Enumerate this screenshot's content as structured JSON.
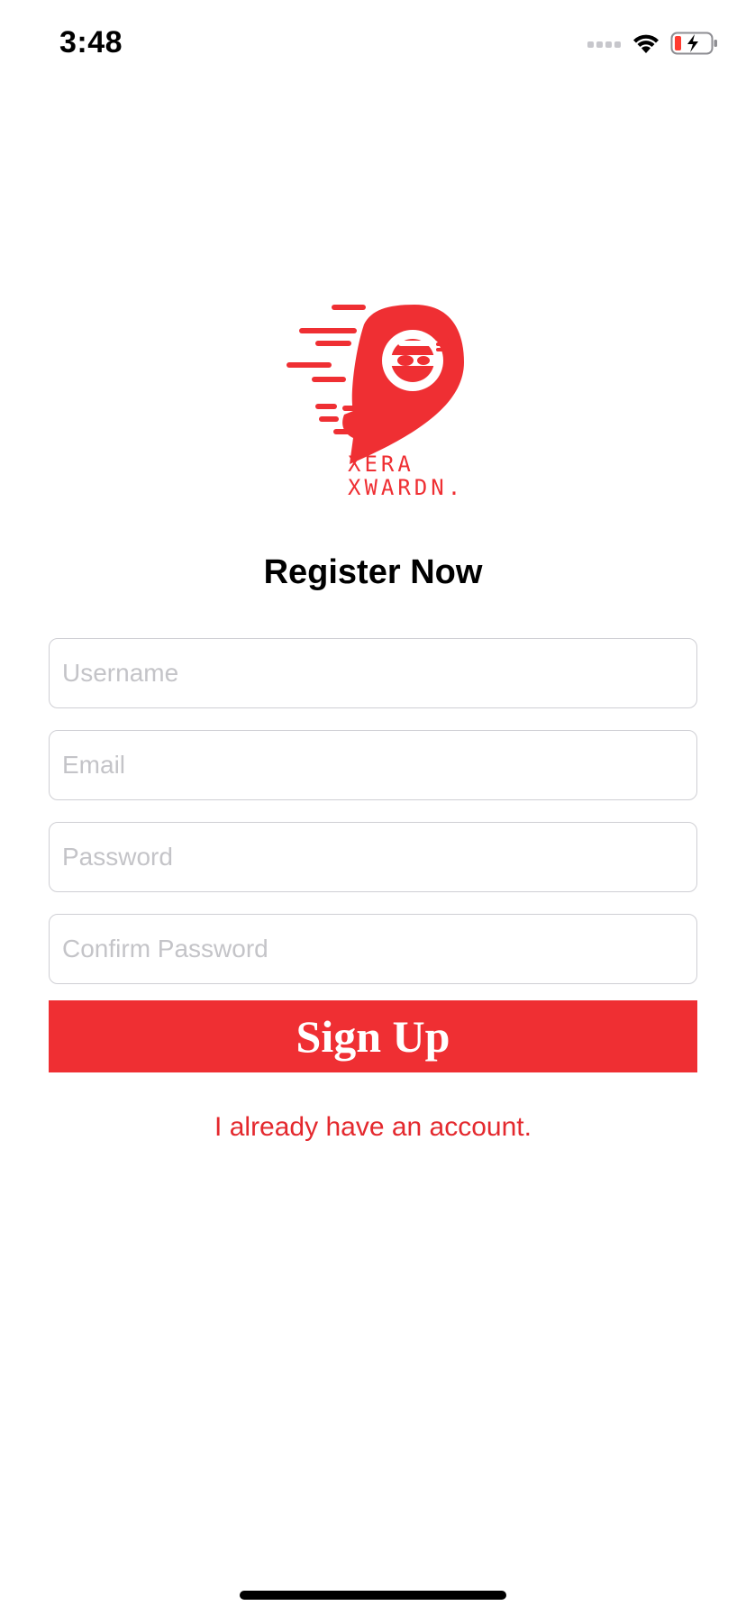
{
  "status_bar": {
    "time": "3:48",
    "icons": [
      "signal-icon",
      "wifi-icon",
      "battery-charging-icon"
    ]
  },
  "logo": {
    "line1": "XERA",
    "line2": "XWARDN."
  },
  "page": {
    "title": "Register Now"
  },
  "form": {
    "username_placeholder": "Username",
    "username_value": "",
    "email_placeholder": "Email",
    "email_value": "",
    "password_placeholder": "Password",
    "password_value": "",
    "confirm_password_placeholder": "Confirm Password",
    "confirm_password_value": "",
    "submit_label": "Sign Up",
    "login_link": "I already have an account."
  },
  "colors": {
    "brand": "#ef2f33",
    "placeholder": "#c4c4c8",
    "border": "#cfcfd4"
  }
}
